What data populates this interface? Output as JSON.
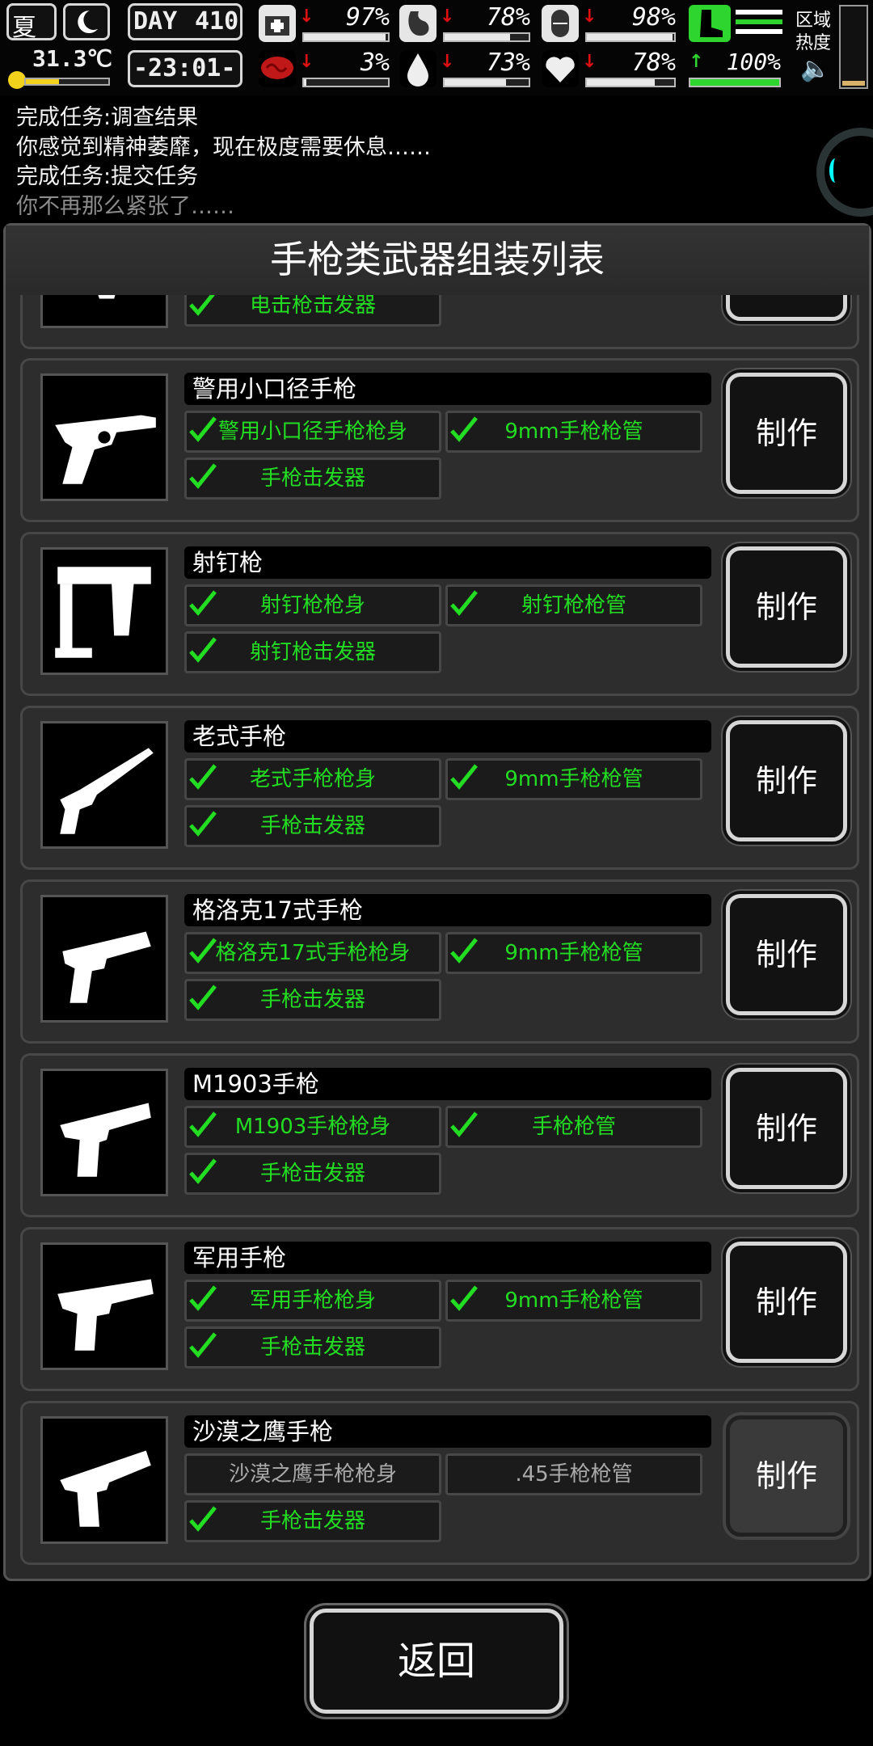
{
  "status": {
    "season": "夏",
    "temperature": "31.3℃",
    "day_label": "DAY",
    "day_number": "410",
    "clock": "-23:01-",
    "stats": [
      {
        "name": "health",
        "icon": "medkit-icon",
        "trend": "down",
        "value": "97%",
        "level": 0.97
      },
      {
        "name": "hunger",
        "icon": "stomach-icon",
        "trend": "down",
        "value": "78%",
        "level": 0.78
      },
      {
        "name": "stamina",
        "icon": "pill-icon",
        "trend": "down",
        "value": "98%",
        "level": 0.98
      },
      {
        "name": "infection",
        "icon": "brain-icon",
        "trend": "down",
        "value": "3%",
        "level": 0.03
      },
      {
        "name": "thirst",
        "icon": "water-drop-icon",
        "trend": "down",
        "value": "73%",
        "level": 0.73
      },
      {
        "name": "mood",
        "icon": "heart-icon",
        "trend": "down",
        "value": "78%",
        "level": 0.78
      },
      {
        "name": "speed",
        "icon": "boot-icon",
        "trend": "up",
        "value": "100%",
        "level": 1.0
      }
    ],
    "zone_heat": "区域热度"
  },
  "log": [
    "完成任务:调查结果",
    "你感觉到精神萎靡，现在极度需要休息……",
    "完成任务:提交任务",
    "你不再那么紧张了……"
  ],
  "panel": {
    "title": "手枪类武器组装列表",
    "make_label": "制作",
    "items": [
      {
        "name": "",
        "parts": [
          {
            "label": "电击枪击发器",
            "owned": true
          }
        ]
      },
      {
        "name": "警用小口径手枪",
        "parts": [
          {
            "label": "警用小口径手枪枪身",
            "owned": true
          },
          {
            "label": "9mm手枪枪管",
            "owned": true
          },
          {
            "label": "手枪击发器",
            "owned": true
          }
        ]
      },
      {
        "name": "射钉枪",
        "parts": [
          {
            "label": "射钉枪枪身",
            "owned": true
          },
          {
            "label": "射钉枪枪管",
            "owned": true
          },
          {
            "label": "射钉枪击发器",
            "owned": true
          }
        ]
      },
      {
        "name": "老式手枪",
        "parts": [
          {
            "label": "老式手枪枪身",
            "owned": true
          },
          {
            "label": "9mm手枪枪管",
            "owned": true
          },
          {
            "label": "手枪击发器",
            "owned": true
          }
        ]
      },
      {
        "name": "格洛克17式手枪",
        "parts": [
          {
            "label": "格洛克17式手枪枪身",
            "owned": true
          },
          {
            "label": "9mm手枪枪管",
            "owned": true
          },
          {
            "label": "手枪击发器",
            "owned": true
          }
        ]
      },
      {
        "name": "M1903手枪",
        "parts": [
          {
            "label": "M1903手枪枪身",
            "owned": true
          },
          {
            "label": "手枪枪管",
            "owned": true
          },
          {
            "label": "手枪击发器",
            "owned": true
          }
        ]
      },
      {
        "name": "军用手枪",
        "parts": [
          {
            "label": "军用手枪枪身",
            "owned": true
          },
          {
            "label": "9mm手枪枪管",
            "owned": true
          },
          {
            "label": "手枪击发器",
            "owned": true
          }
        ]
      },
      {
        "name": "沙漠之鹰手枪",
        "parts": [
          {
            "label": "沙漠之鹰手枪枪身",
            "owned": false
          },
          {
            "label": ".45手枪枪管",
            "owned": false
          },
          {
            "label": "手枪击发器",
            "owned": true
          }
        ]
      }
    ]
  },
  "footer": {
    "back_label": "返回"
  }
}
